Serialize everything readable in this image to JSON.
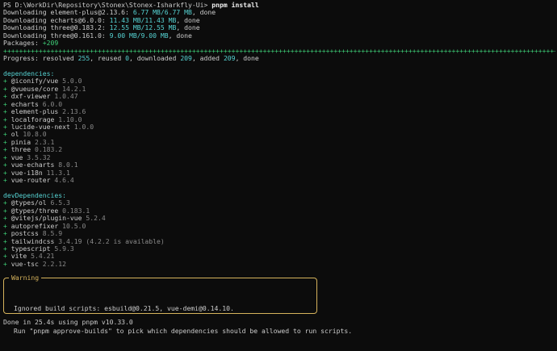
{
  "prompt": {
    "path": "PS D:\\WorkDir\\Repository\\Stonex\\Stonex-Isharkfly-Ui>",
    "command": "pnpm install"
  },
  "downloads": [
    {
      "label": "Downloading element-plus@2.13.6:",
      "amount": "6.77 MB/6.77 MB",
      "status": ", done"
    },
    {
      "label": "Downloading echarts@6.0.0:",
      "amount": "11.43 MB/11.43 MB",
      "status": ", done"
    },
    {
      "label": "Downloading three@0.183.2:",
      "amount": "12.55 MB/12.55 MB",
      "status": ", done"
    },
    {
      "label": "Downloading three@0.161.0:",
      "amount": "9.00 MB/9.00 MB",
      "status": ", done"
    }
  ],
  "packages": {
    "label": "Packages:",
    "value": "+209"
  },
  "separator": "++++++++++++++++++++++++++++++++++++++++++++++++++++++++++++++++++++++++++++++++++++++++++++++++++++++++++++++++++++++++++++++++++++++++++++++++++",
  "progress": {
    "prefix": "Progress: resolved",
    "resolved": "255",
    "reused_label": ", reused",
    "reused": "0",
    "downloaded_label": ", downloaded",
    "downloaded": "209",
    "added_label": ", added",
    "added": "209",
    "suffix": ", done"
  },
  "dependencies": {
    "title": "dependencies:",
    "items": [
      {
        "name": "@iconify/vue",
        "version": "5.0.0"
      },
      {
        "name": "@vueuse/core",
        "version": "14.2.1"
      },
      {
        "name": "dxf-viewer",
        "version": "1.0.47"
      },
      {
        "name": "echarts",
        "version": "6.0.0"
      },
      {
        "name": "element-plus",
        "version": "2.13.6"
      },
      {
        "name": "localforage",
        "version": "1.10.0"
      },
      {
        "name": "lucide-vue-next",
        "version": "1.0.0"
      },
      {
        "name": "ol",
        "version": "10.8.0"
      },
      {
        "name": "pinia",
        "version": "2.3.1"
      },
      {
        "name": "three",
        "version": "0.183.2"
      },
      {
        "name": "vue",
        "version": "3.5.32"
      },
      {
        "name": "vue-echarts",
        "version": "8.0.1"
      },
      {
        "name": "vue-i18n",
        "version": "11.3.1"
      },
      {
        "name": "vue-router",
        "version": "4.6.4"
      }
    ]
  },
  "devDependencies": {
    "title": "devDependencies:",
    "items": [
      {
        "name": "@types/ol",
        "version": "6.5.3"
      },
      {
        "name": "@types/three",
        "version": "0.183.1"
      },
      {
        "name": "@vitejs/plugin-vue",
        "version": "5.2.4"
      },
      {
        "name": "autoprefixer",
        "version": "10.5.0"
      },
      {
        "name": "postcss",
        "version": "8.5.9"
      },
      {
        "name": "tailwindcss",
        "version": "3.4.19 (4.2.2 is available)"
      },
      {
        "name": "typescript",
        "version": "5.9.3"
      },
      {
        "name": "vite",
        "version": "5.4.21"
      },
      {
        "name": "vue-tsc",
        "version": "2.2.12"
      }
    ]
  },
  "plus": "+",
  "warning": {
    "title": "Warning",
    "line1": "Ignored build scripts: esbuild@0.21.5, vue-demi@0.14.10.",
    "line2": "Run \"pnpm approve-builds\" to pick which dependencies should be allowed to run scripts."
  },
  "done": "Done in 25.4s using pnpm v10.33.0",
  "colors": {
    "cyan": "#56d3d3",
    "green": "#3fcf78",
    "warning_border": "#d6b35c",
    "background": "#0c0c0c"
  }
}
